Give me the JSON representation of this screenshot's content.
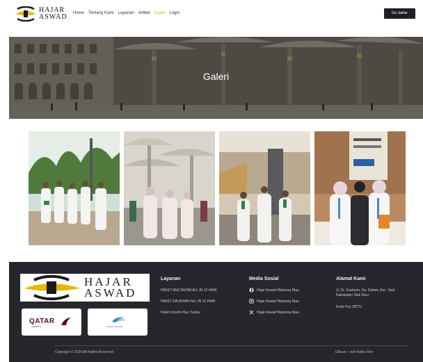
{
  "header": {
    "logo_line1": "HAJAR",
    "logo_line2": "ASWAD",
    "nav": [
      "Home",
      "Tentang Kami",
      "Layanan",
      "Artikel",
      "Galeri",
      "Login"
    ],
    "active_nav": "Galeri",
    "cta_label": "Go daftar"
  },
  "hero": {
    "title": "Galeri"
  },
  "gallery": {
    "photos": [
      "photo-group-garden",
      "photo-umbrellas-courtyard",
      "photo-mosque-interior",
      "photo-women-pilgrims"
    ]
  },
  "footer": {
    "logo_line1": "HAJAR",
    "logo_line2": "ASWAD",
    "partner_qatar": "QATAR",
    "partner_qatar_sub": "AIRWAYS",
    "partner_garuda": "Garuda Indonesia",
    "layanan": {
      "title": "Layanan",
      "items": [
        "PAKET MULTAZAM ALL IN 12 HARI",
        "PAKET RAUDHAH ALL IN 12 HARI",
        "Paket Umroh Plus Turkey"
      ]
    },
    "media_sosial": {
      "title": "Media Sosial",
      "items": [
        "Hajar Aswad Mubaroq Riau",
        "Hajar Aswad Mubaroq Riau",
        "Hajar Aswad Mubaroq Riau"
      ]
    },
    "alamat": {
      "title": "Alamat Kami",
      "address": "Jl. Dr. Soetomo, Kp. Dalam, Kec. Siak, Kabupaten Siak Riau",
      "postal": "Kode Pos 28773"
    },
    "copyright": "Copyright © 2024 All Rights Reserved",
    "made_prefix": "Dibuat",
    "made_suffix": "oleh Nisha Fitri",
    "colors": {
      "bg": "#25272c",
      "accent": "#e6b800",
      "heart": "#e0245e"
    }
  }
}
